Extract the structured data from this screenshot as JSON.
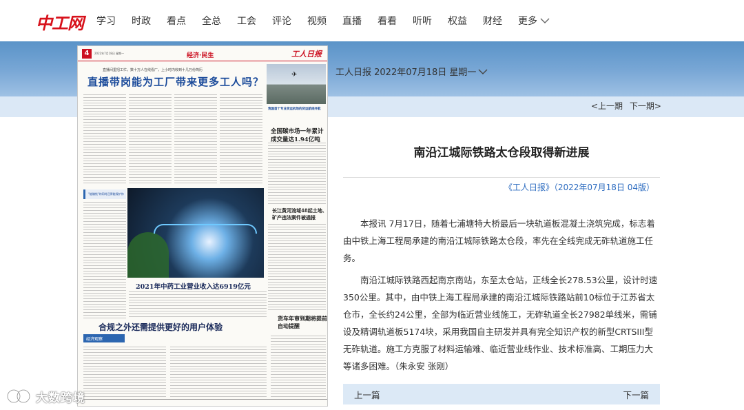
{
  "header": {
    "logo_text": "中工网",
    "nav": [
      "学习",
      "时政",
      "看点",
      "全总",
      "工会",
      "评论",
      "视频",
      "直播",
      "看看",
      "听听",
      "权益",
      "财经"
    ],
    "more_label": "更多"
  },
  "newspaper": {
    "page_number": "4",
    "date_small": "2022年7月18日 星期一",
    "section_label": "经济·民生",
    "masthead": "工人日报",
    "subheadline": "直播间里招工忙，数十万人在线看厂，上小时内收到十几万份简历",
    "headline": "直播带岗能为工厂带来更多工人吗？",
    "photo_caption": "我国首个专业货运机场的货运航线开航",
    "headline_carbon": "全国碳市场一年累计成交量达1.94亿吨",
    "headline_yangtze": "长江黄河流域48起土地、矿产违法案件被通报",
    "headline_pharma": "2021年中药工业营业收入达6919亿元",
    "headline_compliance": "合规之外还需提供更好的用户体验",
    "headline_truck": "货车年审到期将提前自动提醒",
    "side_box": "\"能赚钱\"的同时还得能保护你",
    "bottom_box": "经济观察"
  },
  "article": {
    "date_bar": "工人日报 2022年07月18日 星期一",
    "prev_issue": "<上一期",
    "next_issue": "下一期>",
    "title": "南沿江城际铁路太仓段取得新进展",
    "source": "《工人日报》（2022年07月18日 04版）",
    "paragraphs": [
      "本报讯 7月17日，随着七浦塘特大桥最后一块轨道板混凝土浇筑完成，标志着由中铁上海工程局承建的南沿江城际铁路太仓段，率先在全线完成无砟轨道施工任务。",
      "南沿江城际铁路西起南京南站，东至太仓站，正线全长278.53公里，设计时速350公里。其中，由中铁上海工程局承建的南沿江城际铁路站前10标位于江苏省太仓市，全长约24公里，全部为临近营业线施工，无砟轨道全长27982单线米，需铺设及精调轨道板5174块，采用我国自主研发并具有完全知识产权的新型CRTSIII型无砟轨道。施工方克服了材料运输难、临近营业线作业、技术标准高、工期压力大等诸多困难。（朱永安 张刚）"
    ],
    "prev_article": "上一篇",
    "next_article": "下一篇"
  },
  "watermark": "大数跨境",
  "colors": {
    "brand_red": "#d7101a",
    "band_blue": "#6a9fd0",
    "link_blue": "#2d6cc0",
    "nav_bar_light": "#dce9f6"
  }
}
